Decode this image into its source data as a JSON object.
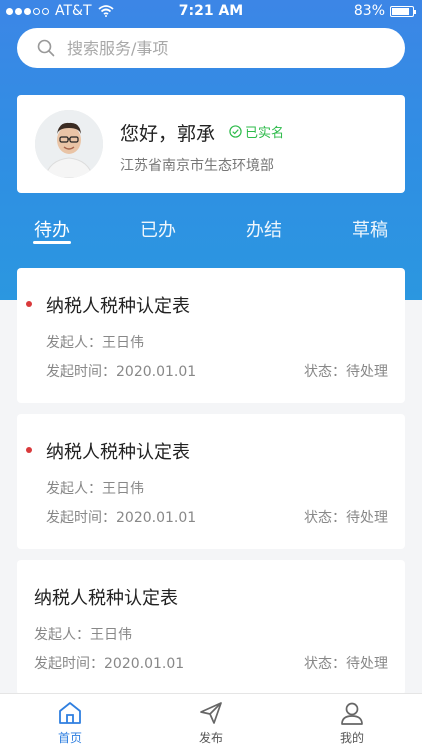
{
  "status_bar": {
    "carrier": "AT&T",
    "time": "7:21 AM",
    "battery": "83%"
  },
  "search": {
    "placeholder": "搜索服务/事项"
  },
  "profile": {
    "greeting": "您好，郭承",
    "verified_label": "已实名",
    "organization": "江苏省南京市生态环境部"
  },
  "tabs": [
    {
      "label": "待办",
      "active": true
    },
    {
      "label": "已办",
      "active": false
    },
    {
      "label": "办结",
      "active": false
    },
    {
      "label": "草稿",
      "active": false
    }
  ],
  "tasks": [
    {
      "title": "纳税人税种认定表",
      "initiator": "发起人：王日伟",
      "time": "发起时间：2020.01.01",
      "status": "状态：待处理",
      "unread": true
    },
    {
      "title": "纳税人税种认定表",
      "initiator": "发起人：王日伟",
      "time": "发起时间：2020.01.01",
      "status": "状态：待处理",
      "unread": true
    },
    {
      "title": "纳税人税种认定表",
      "initiator": "发起人：王日伟",
      "time": "发起时间：2020.01.01",
      "status": "状态：待处理",
      "unread": false
    }
  ],
  "bottom_nav": [
    {
      "label": "首页",
      "icon": "home-icon",
      "active": true
    },
    {
      "label": "发布",
      "icon": "send-icon",
      "active": false
    },
    {
      "label": "我的",
      "icon": "user-icon",
      "active": false
    }
  ],
  "colors": {
    "brand_blue": "#2f8fe3",
    "active_nav": "#2f7fe0",
    "verified_green": "#2dbb4a",
    "unread_dot": "#d9393b"
  }
}
